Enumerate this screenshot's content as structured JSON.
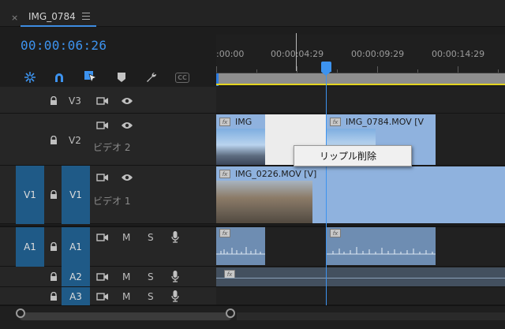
{
  "panel": {
    "close": "×",
    "title": "IMG_0784"
  },
  "timecode": "00:00:06:26",
  "ruler": {
    "labels": [
      ":00:00",
      "00:00:04:29",
      "00:00:09:29",
      "00:00:14:29"
    ]
  },
  "video_tracks": {
    "v3": {
      "label": "V3"
    },
    "v2": {
      "label": "V2",
      "name": "ビデオ 2"
    },
    "v1": {
      "source": "V1",
      "label": "V1",
      "name": "ビデオ 1"
    }
  },
  "audio_tracks": {
    "a1": {
      "source": "A1",
      "label": "A1",
      "mute": "M",
      "solo": "S"
    },
    "a2": {
      "label": "A2",
      "mute": "M",
      "solo": "S"
    },
    "a3": {
      "label": "A3",
      "mute": "M",
      "solo": "S"
    }
  },
  "clips": {
    "v2_left": {
      "fx": "fx",
      "name": "IMG"
    },
    "v2_right": {
      "fx": "fx",
      "name": "IMG_0784.MOV [V"
    },
    "v1": {
      "fx": "fx",
      "name": "IMG_0226.MOV [V]"
    },
    "a1_left": {
      "fx": "fx"
    },
    "a1_right": {
      "fx": "fx"
    },
    "a2": {
      "fx": "fx"
    }
  },
  "context_menu": {
    "item": "リップル削除"
  },
  "toolbar": {
    "icons": [
      "nest-sequence-icon",
      "snap-magnet-icon",
      "linked-selection-icon",
      "add-marker-icon",
      "settings-wrench-icon",
      "captions-icon"
    ],
    "captions_label": "CC"
  },
  "colors": {
    "accent": "#3d93ef",
    "track_target": "#1f5a87",
    "video_clip": "#8fb2de",
    "audio_clip": "#6e8db2",
    "work_area": "#e4d420"
  }
}
